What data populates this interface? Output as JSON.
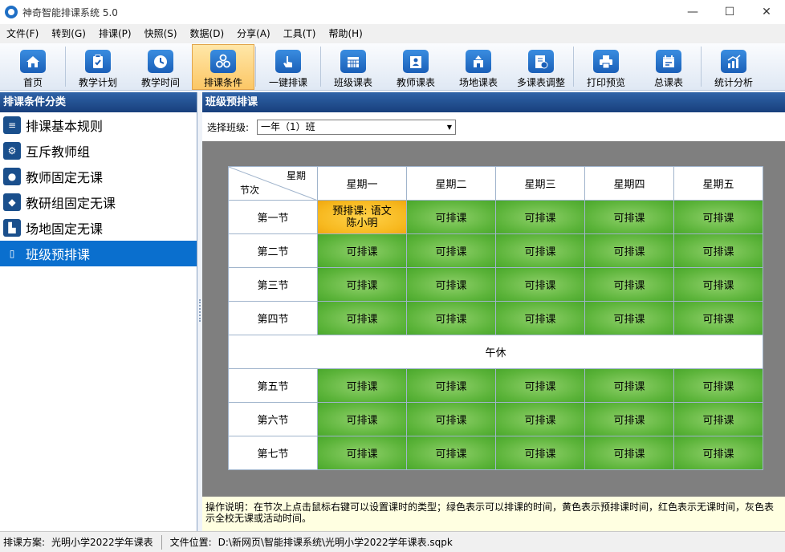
{
  "window": {
    "title": "神奇智能排课系统 5.0",
    "minimize": "—",
    "maximize": "☐",
    "close": "✕"
  },
  "menu": [
    "文件(F)",
    "转到(G)",
    "排课(P)",
    "快照(S)",
    "数据(D)",
    "分享(A)",
    "工具(T)",
    "帮助(H)"
  ],
  "toolbar": [
    {
      "label": "首页",
      "icon": "home-icon"
    },
    {
      "label": "教学计划",
      "icon": "clipboard-icon"
    },
    {
      "label": "教学时间",
      "icon": "clock-icon"
    },
    {
      "label": "排课条件",
      "icon": "cubes-icon",
      "active": true
    },
    {
      "label": "一键排课",
      "icon": "hand-pointer-icon"
    },
    {
      "label": "班级课表",
      "icon": "calendar-icon"
    },
    {
      "label": "教师课表",
      "icon": "teacher-icon"
    },
    {
      "label": "场地课表",
      "icon": "building-icon"
    },
    {
      "label": "多课表调整",
      "icon": "adjust-icon"
    },
    {
      "label": "打印预览",
      "icon": "printer-icon"
    },
    {
      "label": "总课表",
      "icon": "schedule-icon"
    },
    {
      "label": "统计分析",
      "icon": "chart-icon"
    }
  ],
  "left_panel": {
    "title": "排课条件分类",
    "items": [
      {
        "label": "排课基本规则",
        "icon": "rules-icon"
      },
      {
        "label": "互斥教师组",
        "icon": "exclusive-teachers-icon"
      },
      {
        "label": "教师固定无课",
        "icon": "teacher-fixed-icon"
      },
      {
        "label": "教研组固定无课",
        "icon": "group-fixed-icon"
      },
      {
        "label": "场地固定无课",
        "icon": "venue-fixed-icon"
      },
      {
        "label": "班级预排课",
        "icon": "book-icon",
        "selected": true
      }
    ]
  },
  "right_panel": {
    "title": "班级预排课",
    "select_label": "选择班级:",
    "select_value": "一年（1）班",
    "corner_top": "星期",
    "corner_bottom": "节次",
    "days": [
      "星期一",
      "星期二",
      "星期三",
      "星期四",
      "星期五"
    ],
    "periods_morning": [
      "第一节",
      "第二节",
      "第三节",
      "第四节"
    ],
    "lunch": "午休",
    "periods_afternoon": [
      "第五节",
      "第六节",
      "第七节"
    ],
    "available": "可排课",
    "prescheduled_line1": "预排课: 语文",
    "prescheduled_line2": "陈小明",
    "instructions": "操作说明：在节次上点击鼠标右键可以设置课时的类型；绿色表示可以排课的时间，黄色表示预排课时间，红色表示无课时间，灰色表示全校无课或活动时间。"
  },
  "colors": {
    "available": "#5cb43a",
    "prescheduled": "#f7b920",
    "header": "#1f4f8f",
    "selected": "#0a6fce"
  },
  "status": {
    "plan_label": "排课方案:",
    "plan_value": "光明小学2022学年课表",
    "file_label": "文件位置:",
    "file_value": "D:\\新网页\\智能排课系统\\光明小学2022学年课表.sqpk"
  }
}
